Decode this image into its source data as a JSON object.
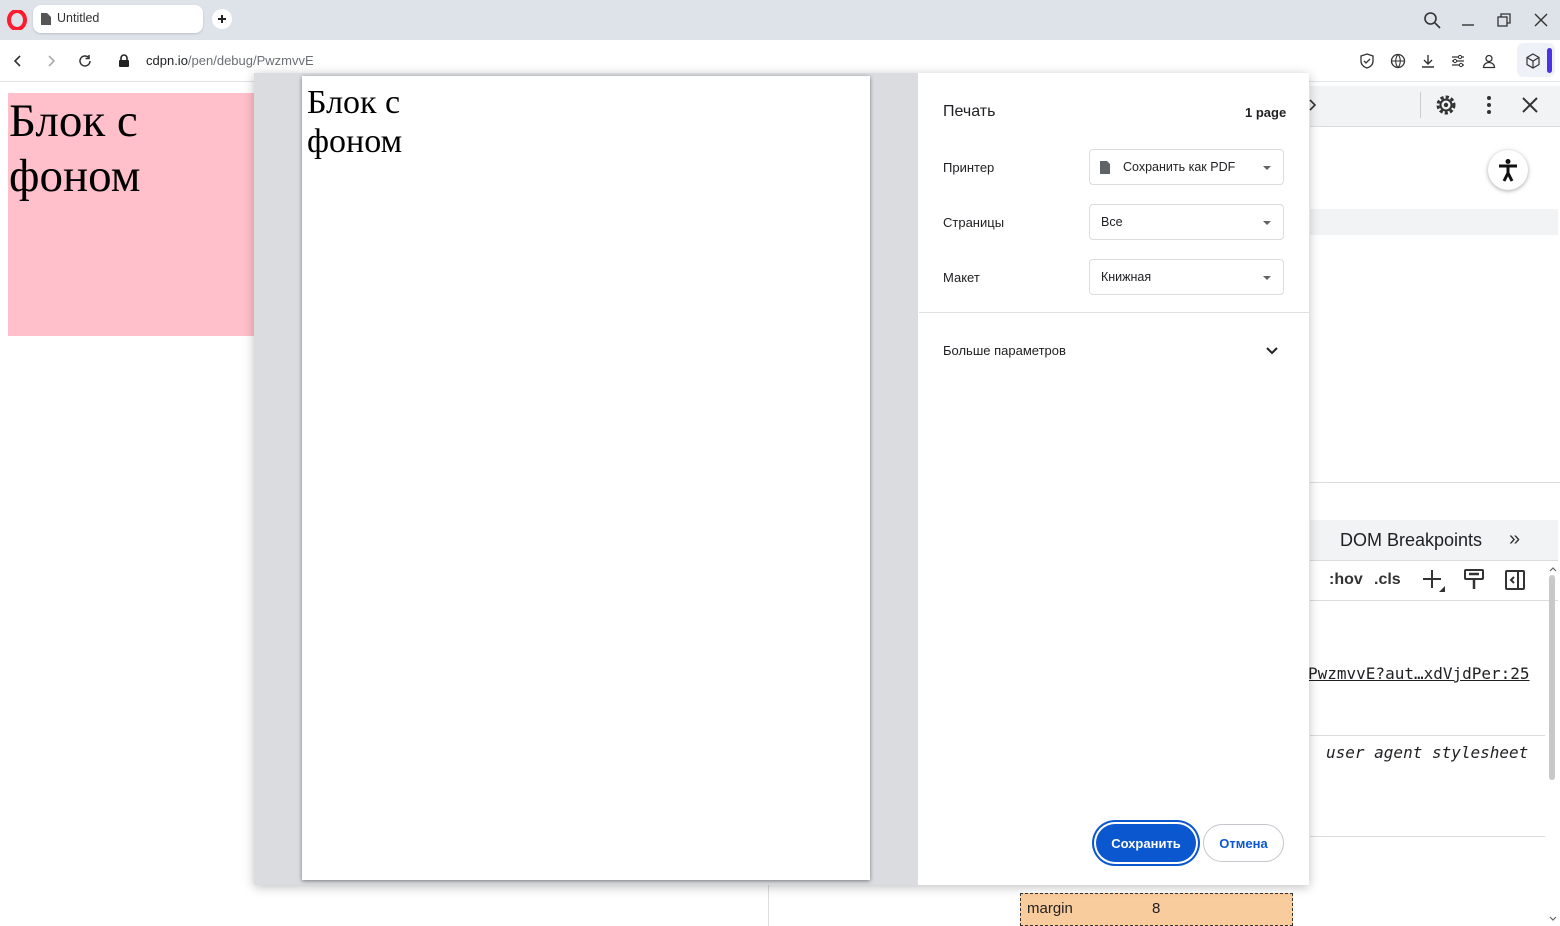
{
  "browser": {
    "tab_title": "Untitled",
    "url_domain": "cdpn.io",
    "url_path": "/pen/debug/PwzmvvE"
  },
  "page": {
    "heading_text": "Блок с фоном",
    "block_color": "#ffc0cb"
  },
  "devtools": {
    "tab_dom_breakpoints": "DOM Breakpoints",
    "overflow_chevrons": "»",
    "hov": ":hov",
    "cls": ".cls",
    "source_link": "PwzmvvE?aut…xdVjdPer:25",
    "ua_stylesheet": "user agent stylesheet",
    "box_model": {
      "margin_label": "margin",
      "margin_value": "8"
    }
  },
  "print_dialog": {
    "title": "Печать",
    "page_count": "1 page",
    "printer_label": "Принтер",
    "printer_value": "Сохранить как PDF",
    "pages_label": "Страницы",
    "pages_value": "Все",
    "layout_label": "Макет",
    "layout_value": "Книжная",
    "more_settings": "Больше параметров",
    "save_label": "Сохранить",
    "cancel_label": "Отмена",
    "preview_text": "Блок с фоном",
    "accent_color": "#0b57d0"
  }
}
